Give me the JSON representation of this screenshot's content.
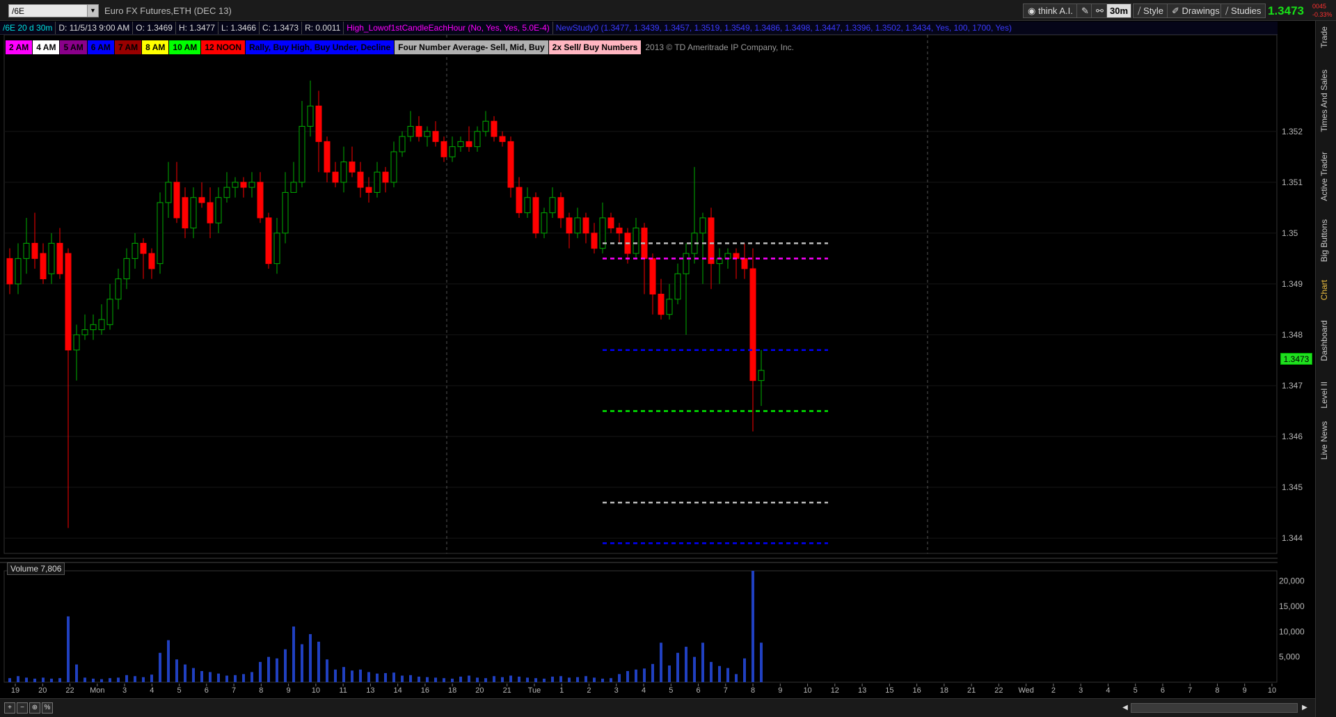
{
  "header": {
    "symbol": "/6E",
    "dropdown_arrow": "▼",
    "description": "Euro FX Futures,ETH (DEC 13)",
    "think_ai": "think A.I.",
    "period": "30m",
    "style": "Style",
    "drawings": "Drawings",
    "studies": "Studies",
    "last_price": "1.3473",
    "change_a": "0045",
    "change_b": "-0.33%"
  },
  "info": {
    "chart_id": "/6E 20 d 30m",
    "date": "D: 11/5/13 9:00 AM",
    "open": "O: 1.3469",
    "high": "H: 1.3477",
    "low": "L: 1.3466",
    "close": "C: 1.3473",
    "range": "R: 0.0011",
    "study1": "High_Lowof1stCandleEachHour (No, Yes, Yes, 5.0E-4)",
    "study2": "NewStudy0 (1.3477, 1.3439, 1.3457, 1.3519, 1.3549, 1.3486, 1.3498, 1.3447, 1.3396, 1.3502, 1.3434, Yes, 100, 1700, Yes)"
  },
  "legend": [
    {
      "label": "2 AM",
      "bg": "#ff00ff",
      "fg": "#000000"
    },
    {
      "label": "4 AM",
      "bg": "#ffffff",
      "fg": "#000000"
    },
    {
      "label": "5 AM",
      "bg": "#8a008a",
      "fg": "#000000"
    },
    {
      "label": "6 AM",
      "bg": "#0000ff",
      "fg": "#000000"
    },
    {
      "label": "7 AM",
      "bg": "#990000",
      "fg": "#000000"
    },
    {
      "label": "8 AM",
      "bg": "#ffff00",
      "fg": "#000000"
    },
    {
      "label": "10 AM",
      "bg": "#00ff00",
      "fg": "#000000"
    },
    {
      "label": "12 NOON",
      "bg": "#ff0000",
      "fg": "#000000"
    },
    {
      "label": "Rally, Buy High, Buy Under, Decline",
      "bg": "#0000ff",
      "fg": "#000000"
    },
    {
      "label": "Four Number Average- Sell, Mid, Buy",
      "bg": "#b0b0b0",
      "fg": "#000000"
    },
    {
      "label": "2x Sell/ Buy Numbers",
      "bg": "#ffb6c1",
      "fg": "#000000"
    }
  ],
  "copyright": "2013 © TD Ameritrade IP Company, Inc.",
  "price_tag": "1.3473",
  "volume_label": "Volume",
  "volume_value": "7,806",
  "sidetabs": [
    "Trade",
    "Times And Sales",
    "Active Trader",
    "Big Buttons",
    "Chart",
    "Dashboard",
    "Level II",
    "Live News"
  ],
  "active_tab": "Chart",
  "bottom_icons": [
    "zoom-in",
    "zoom-out",
    "crosshair",
    "percent"
  ],
  "chart_data": {
    "type": "candlestick",
    "y_ticks": [
      "1.344",
      "1.345",
      "1.346",
      "1.347",
      "1.348",
      "1.349",
      "1.35",
      "1.351",
      "1.352"
    ],
    "y_range": [
      1.3437,
      1.3539
    ],
    "x_ticks": [
      "19",
      "20",
      "22",
      "Mon",
      "3",
      "4",
      "5",
      "6",
      "7",
      "8",
      "9",
      "10",
      "11",
      "13",
      "14",
      "16",
      "18",
      "20",
      "21",
      "Tue",
      "1",
      "2",
      "3",
      "4",
      "5",
      "6",
      "7",
      "8",
      "9",
      "10",
      "12",
      "13",
      "15",
      "16",
      "18",
      "21",
      "22",
      "Wed",
      "2",
      "3",
      "4",
      "5",
      "6",
      "7",
      "8",
      "9",
      "10"
    ],
    "volume_ticks": [
      "5,000",
      "10,000",
      "15,000",
      "20,000"
    ],
    "volume_range": [
      0,
      22000
    ],
    "levels": [
      {
        "value": 1.3498,
        "color": "#bbbbbb"
      },
      {
        "value": 1.3495,
        "color": "#ff00ff"
      },
      {
        "value": 1.3477,
        "color": "#0000ff"
      },
      {
        "value": 1.3465,
        "color": "#00ee00"
      },
      {
        "value": 1.3447,
        "color": "#bbbbbb"
      },
      {
        "value": 1.3439,
        "color": "#0000ff"
      }
    ],
    "candles": [
      [
        1.3495,
        1.349,
        1.3497,
        1.3488,
        800
      ],
      [
        1.349,
        1.3495,
        1.3498,
        1.3488,
        1200
      ],
      [
        1.3495,
        1.3498,
        1.3503,
        1.3492,
        900
      ],
      [
        1.3498,
        1.3495,
        1.3504,
        1.3493,
        700
      ],
      [
        1.3496,
        1.3491,
        1.3498,
        1.349,
        900
      ],
      [
        1.3492,
        1.3498,
        1.35,
        1.349,
        700
      ],
      [
        1.3498,
        1.3492,
        1.3501,
        1.3491,
        800
      ],
      [
        1.3496,
        1.3477,
        1.3497,
        1.3442,
        13000
      ],
      [
        1.3477,
        1.348,
        1.3482,
        1.3471,
        3500
      ],
      [
        1.348,
        1.3481,
        1.3484,
        1.3479,
        900
      ],
      [
        1.3481,
        1.3482,
        1.3484,
        1.3479,
        700
      ],
      [
        1.3481,
        1.3483,
        1.3486,
        1.348,
        600
      ],
      [
        1.3482,
        1.3487,
        1.349,
        1.3481,
        800
      ],
      [
        1.3487,
        1.3491,
        1.3493,
        1.3485,
        900
      ],
      [
        1.3491,
        1.3495,
        1.3497,
        1.3489,
        1400
      ],
      [
        1.3495,
        1.3498,
        1.35,
        1.3493,
        1200
      ],
      [
        1.3498,
        1.3496,
        1.3499,
        1.3491,
        1000
      ],
      [
        1.3496,
        1.3493,
        1.3497,
        1.3491,
        1500
      ],
      [
        1.3494,
        1.3506,
        1.3508,
        1.3492,
        5800
      ],
      [
        1.3506,
        1.351,
        1.3514,
        1.3503,
        8300
      ],
      [
        1.351,
        1.3503,
        1.3514,
        1.3502,
        4500
      ],
      [
        1.3507,
        1.3501,
        1.3509,
        1.3499,
        3500
      ],
      [
        1.3501,
        1.3507,
        1.3509,
        1.3499,
        2800
      ],
      [
        1.3507,
        1.3506,
        1.351,
        1.3505,
        2200
      ],
      [
        1.3506,
        1.3502,
        1.3509,
        1.3499,
        2000
      ],
      [
        1.3502,
        1.3507,
        1.3509,
        1.35,
        1700
      ],
      [
        1.3507,
        1.3509,
        1.3512,
        1.3506,
        1300
      ],
      [
        1.3509,
        1.351,
        1.3511,
        1.3507,
        1400
      ],
      [
        1.351,
        1.3509,
        1.3511,
        1.3507,
        1600
      ],
      [
        1.3509,
        1.351,
        1.3512,
        1.3507,
        2000
      ],
      [
        1.351,
        1.3503,
        1.3512,
        1.3502,
        4000
      ],
      [
        1.3503,
        1.3494,
        1.3504,
        1.3493,
        5000
      ],
      [
        1.3494,
        1.35,
        1.3503,
        1.3492,
        4700
      ],
      [
        1.35,
        1.3508,
        1.3512,
        1.3498,
        6500
      ],
      [
        1.3508,
        1.351,
        1.3514,
        1.3509,
        11000
      ],
      [
        1.351,
        1.3521,
        1.3526,
        1.3509,
        7500
      ],
      [
        1.3521,
        1.3525,
        1.353,
        1.3519,
        9500
      ],
      [
        1.3525,
        1.3518,
        1.3528,
        1.3512,
        8000
      ],
      [
        1.3518,
        1.3512,
        1.3519,
        1.351,
        4500
      ],
      [
        1.3512,
        1.351,
        1.3514,
        1.3509,
        2500
      ],
      [
        1.351,
        1.3514,
        1.3517,
        1.3508,
        3000
      ],
      [
        1.3514,
        1.3512,
        1.3517,
        1.3511,
        2300
      ],
      [
        1.3512,
        1.3509,
        1.3514,
        1.3507,
        2500
      ],
      [
        1.3509,
        1.3508,
        1.3511,
        1.3506,
        2000
      ],
      [
        1.3508,
        1.3512,
        1.3514,
        1.3507,
        1700
      ],
      [
        1.3512,
        1.351,
        1.3513,
        1.3508,
        1800
      ],
      [
        1.351,
        1.3516,
        1.3518,
        1.3509,
        1900
      ],
      [
        1.3516,
        1.3519,
        1.352,
        1.3515,
        1300
      ],
      [
        1.3519,
        1.3521,
        1.3524,
        1.3518,
        1400
      ],
      [
        1.3521,
        1.3519,
        1.3523,
        1.3518,
        1100
      ],
      [
        1.3519,
        1.352,
        1.3521,
        1.3517,
        1000
      ],
      [
        1.352,
        1.3518,
        1.3522,
        1.3517,
        900
      ],
      [
        1.3518,
        1.3515,
        1.3519,
        1.3514,
        800
      ],
      [
        1.3515,
        1.3517,
        1.3519,
        1.3514,
        700
      ],
      [
        1.3517,
        1.3518,
        1.3519,
        1.3516,
        1100
      ],
      [
        1.3518,
        1.3517,
        1.3521,
        1.3516,
        1300
      ],
      [
        1.3517,
        1.352,
        1.3521,
        1.3516,
        900
      ],
      [
        1.352,
        1.3522,
        1.3524,
        1.3519,
        800
      ],
      [
        1.3522,
        1.3519,
        1.3523,
        1.3518,
        1200
      ],
      [
        1.3519,
        1.3518,
        1.352,
        1.3517,
        1000
      ],
      [
        1.3518,
        1.3509,
        1.3519,
        1.3507,
        1300
      ],
      [
        1.3509,
        1.3504,
        1.3511,
        1.3503,
        1100
      ],
      [
        1.3504,
        1.3507,
        1.3509,
        1.3503,
        900
      ],
      [
        1.3507,
        1.35,
        1.3508,
        1.3499,
        800
      ],
      [
        1.35,
        1.3504,
        1.3505,
        1.3499,
        700
      ],
      [
        1.3504,
        1.3507,
        1.3509,
        1.3503,
        1100
      ],
      [
        1.3507,
        1.3503,
        1.3508,
        1.3501,
        1200
      ],
      [
        1.3503,
        1.35,
        1.3504,
        1.3497,
        900
      ],
      [
        1.35,
        1.3503,
        1.3505,
        1.3499,
        1000
      ],
      [
        1.3503,
        1.35,
        1.3504,
        1.3498,
        1200
      ],
      [
        1.35,
        1.3497,
        1.3502,
        1.3496,
        900
      ],
      [
        1.3497,
        1.3503,
        1.3506,
        1.3496,
        700
      ],
      [
        1.3503,
        1.3501,
        1.3504,
        1.35,
        800
      ],
      [
        1.3501,
        1.35,
        1.3502,
        1.3498,
        1600
      ],
      [
        1.35,
        1.3496,
        1.3501,
        1.3494,
        2200
      ],
      [
        1.3496,
        1.3501,
        1.3503,
        1.3495,
        2500
      ],
      [
        1.3501,
        1.3495,
        1.3502,
        1.3488,
        2700
      ],
      [
        1.3495,
        1.3488,
        1.3496,
        1.3484,
        3600
      ],
      [
        1.3488,
        1.3484,
        1.3491,
        1.3483,
        7800
      ],
      [
        1.3484,
        1.3487,
        1.349,
        1.3483,
        3300
      ],
      [
        1.3487,
        1.3492,
        1.3494,
        1.3486,
        5800
      ],
      [
        1.3492,
        1.3496,
        1.3498,
        1.348,
        7000
      ],
      [
        1.3496,
        1.35,
        1.3513,
        1.3494,
        5000
      ],
      [
        1.35,
        1.3503,
        1.3504,
        1.349,
        7800
      ],
      [
        1.3503,
        1.3494,
        1.3505,
        1.3489,
        4000
      ],
      [
        1.3494,
        1.3495,
        1.3497,
        1.349,
        3200
      ],
      [
        1.3495,
        1.3496,
        1.3497,
        1.3493,
        2800
      ],
      [
        1.3496,
        1.3495,
        1.3497,
        1.3491,
        1600
      ],
      [
        1.3495,
        1.3493,
        1.3498,
        1.3491,
        4700
      ],
      [
        1.3493,
        1.3471,
        1.3497,
        1.3461,
        22000
      ],
      [
        1.3471,
        1.3473,
        1.3477,
        1.3466,
        7806
      ]
    ]
  }
}
